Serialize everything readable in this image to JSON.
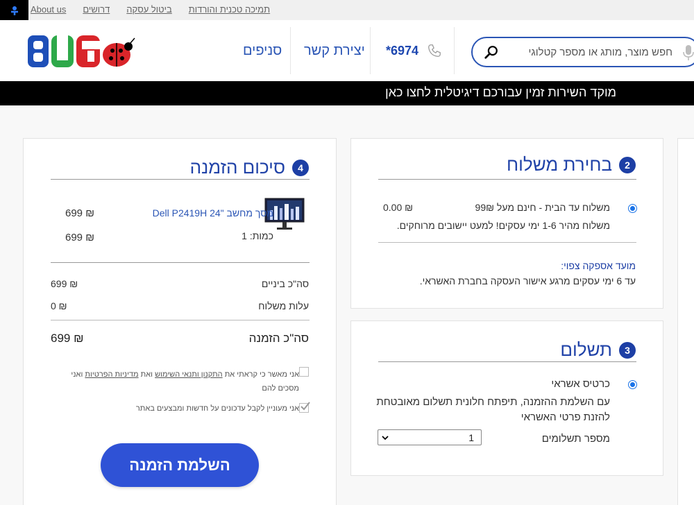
{
  "topbar": {
    "about": "About us",
    "jobs": "דרושים",
    "cancel_deal": "ביטול עסקה",
    "support": "תמיכה טכנית והורדות"
  },
  "header": {
    "stores": "סניפים",
    "contact": "יצירת קשר",
    "phone": "*6974",
    "search_placeholder": "חפש מוצר, מותג או מספר קטלוגי"
  },
  "banner": {
    "text": "מוקד השירות זמין עבורכם דיגיטלית לחצו כאן"
  },
  "shipping": {
    "step": "2",
    "title": "בחירת משלוח",
    "option_label": "משלוח עד הבית - חינם מעל 99₪",
    "option_price": "0.00 ₪",
    "option_desc": "משלוח מהיר 1-6 ימי עסקים! למעט יישובים מרוחקים.",
    "delivery_title": "מועד אספקה צפוי:",
    "delivery_text": "עד 6 ימי עסקים מרגע אישור העסקה בחברת האשראי."
  },
  "payment": {
    "step": "3",
    "title": "תשלום",
    "method": "כרטיס אשראי",
    "note_line1": "עם השלמת ההזמנה, תיפתח חלונית תשלום מאובטחת",
    "note_line2": "להזנת פרטי האשראי",
    "installments_label": "מספר תשלומים",
    "installments_value": "1"
  },
  "summary": {
    "step": "4",
    "title": "סיכום הזמנה",
    "product_name": "מסך מחשב \"24 Dell P2419H",
    "product_price": "699 ₪",
    "quantity_label": "כמות: 1",
    "line_total": "699 ₪",
    "subtotal_label": "סה\"כ ביניים",
    "subtotal_value": "699 ₪",
    "shipping_label": "עלות משלוח",
    "shipping_value": "0 ₪",
    "total_label": "סה\"כ הזמנה",
    "total_value": "699 ₪",
    "terms_prefix": "אני מאשר כי קראתי את",
    "terms_link": "התקנון ותנאי השימוש",
    "terms_and": "ואת",
    "privacy_link": "מדיניות הפרטיות",
    "terms_suffix_a": "ואני",
    "terms_suffix_b": "מסכים להם",
    "newsletter": "אני מעוניין לקבל עדכונים על חדשות ומבצעים באתר",
    "complete_button": "השלמת הזמנה"
  },
  "colors": {
    "brand_blue": "#2a55b5",
    "button_blue": "#2f52d6",
    "step_blue": "#1d3fa5"
  }
}
